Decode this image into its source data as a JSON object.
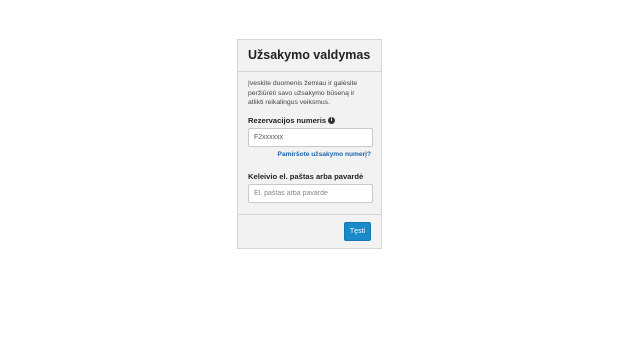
{
  "panel": {
    "title": "Užsakymo valdymas",
    "intro": "Įveskite duomenis žemiau ir galėsite peržiūrėti savo užsakymo būseną ir atlikti reikalingus veiksmus.",
    "reservation": {
      "label": "Rezervacijos numeris",
      "value": "F2xxxxxx",
      "info_icon": "info-circle-icon"
    },
    "forgot_link": "Pamiršote užsakymo numerį?",
    "traveler": {
      "label": "Keleivio el. paštas arba pavardė",
      "placeholder": "El. paštas arba pavardė",
      "value": ""
    },
    "continue_label": "Tęsti"
  },
  "colors": {
    "button": "#1b8ac9",
    "link": "#1d64a8",
    "panel_bg": "#f2f2f2"
  }
}
